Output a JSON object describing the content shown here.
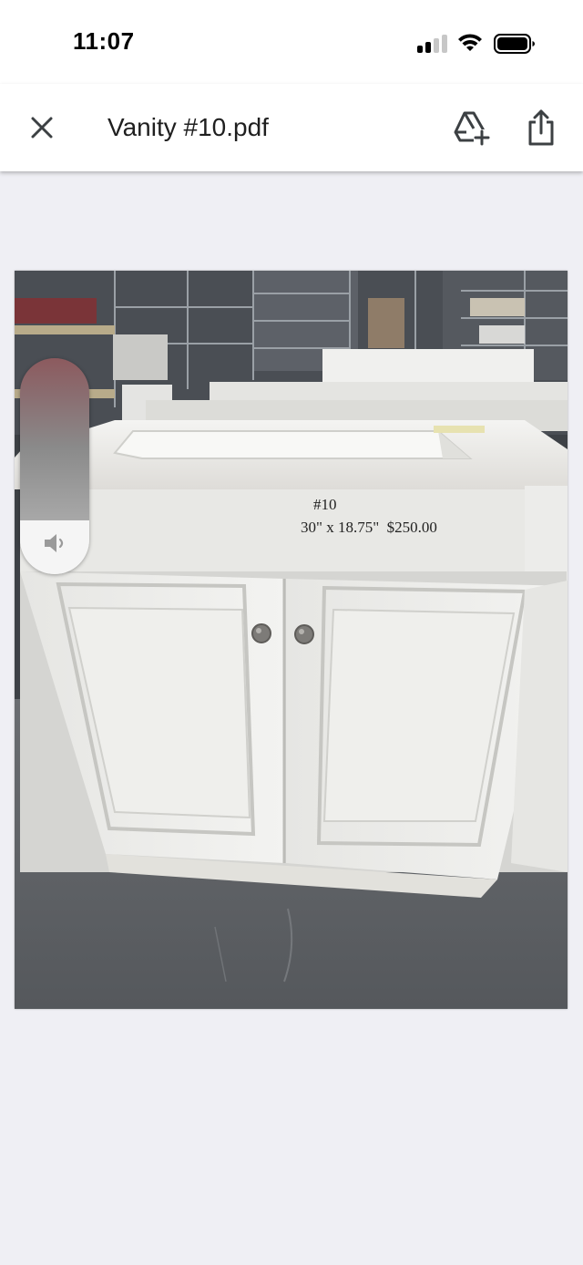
{
  "status_bar": {
    "time": "11:07",
    "icons": [
      "cellular-signal-icon",
      "wifi-icon",
      "battery-icon"
    ]
  },
  "header": {
    "title": "Vanity #10.pdf",
    "actions": [
      "close-icon",
      "add-to-drive-icon",
      "share-icon"
    ]
  },
  "document": {
    "photo_caption_id": "#10",
    "photo_caption_spec": "30\" x 18.75\"  $250.00"
  },
  "audio_control": {
    "icon": "speaker-icon"
  },
  "colors": {
    "viewer_background": "#efeff4",
    "header_background": "#ffffff",
    "vanity_white": "#e9e9e6",
    "floor_gray": "#5f6266"
  }
}
